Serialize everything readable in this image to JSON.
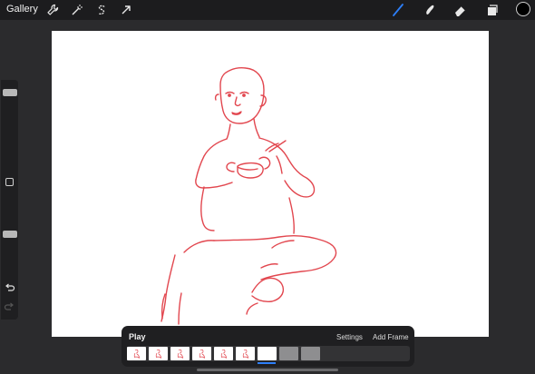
{
  "topbar": {
    "gallery_label": "Gallery",
    "left_tools": [
      "wrench-icon",
      "magic-wand-icon",
      "selection-s-icon",
      "transform-arrow-icon"
    ],
    "right_tools": [
      "brush-icon",
      "smudge-icon",
      "eraser-icon",
      "layers-icon"
    ],
    "color": "#000000",
    "active_tool_color": "#2d7ff9"
  },
  "sidebar": {
    "icons": [
      "modify-square-icon",
      "undo-icon",
      "redo-icon"
    ]
  },
  "animation": {
    "title": "Play",
    "settings_label": "Settings",
    "add_frame_label": "Add Frame",
    "frames": [
      {
        "state": "drawn"
      },
      {
        "state": "drawn"
      },
      {
        "state": "drawn"
      },
      {
        "state": "drawn"
      },
      {
        "state": "drawn"
      },
      {
        "state": "drawn"
      },
      {
        "state": "blank-selected"
      },
      {
        "state": "empty"
      },
      {
        "state": "empty"
      }
    ]
  },
  "sketch": {
    "stroke_color": "#e2474f"
  }
}
